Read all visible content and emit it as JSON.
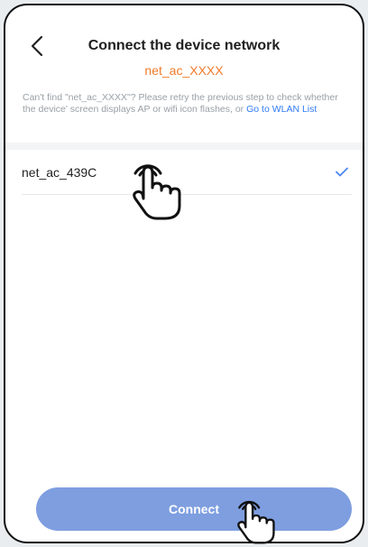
{
  "header": {
    "title": "Connect the device network",
    "target_ssid": "net_ac_XXXX"
  },
  "help": {
    "text": "Can't find \"net_ac_XXXX\"? Please retry the previous step to check whether the device' screen displays AP or wifi icon flashes, or ",
    "link": "Go to WLAN List"
  },
  "networks": [
    {
      "ssid": "net_ac_439C",
      "selected": true
    }
  ],
  "footer": {
    "connect_label": "Connect"
  },
  "colors": {
    "accent_orange": "#f07a2a",
    "link_blue": "#2f7cf6",
    "button_blue": "#7e9ee0",
    "check_blue": "#4a86f0"
  }
}
